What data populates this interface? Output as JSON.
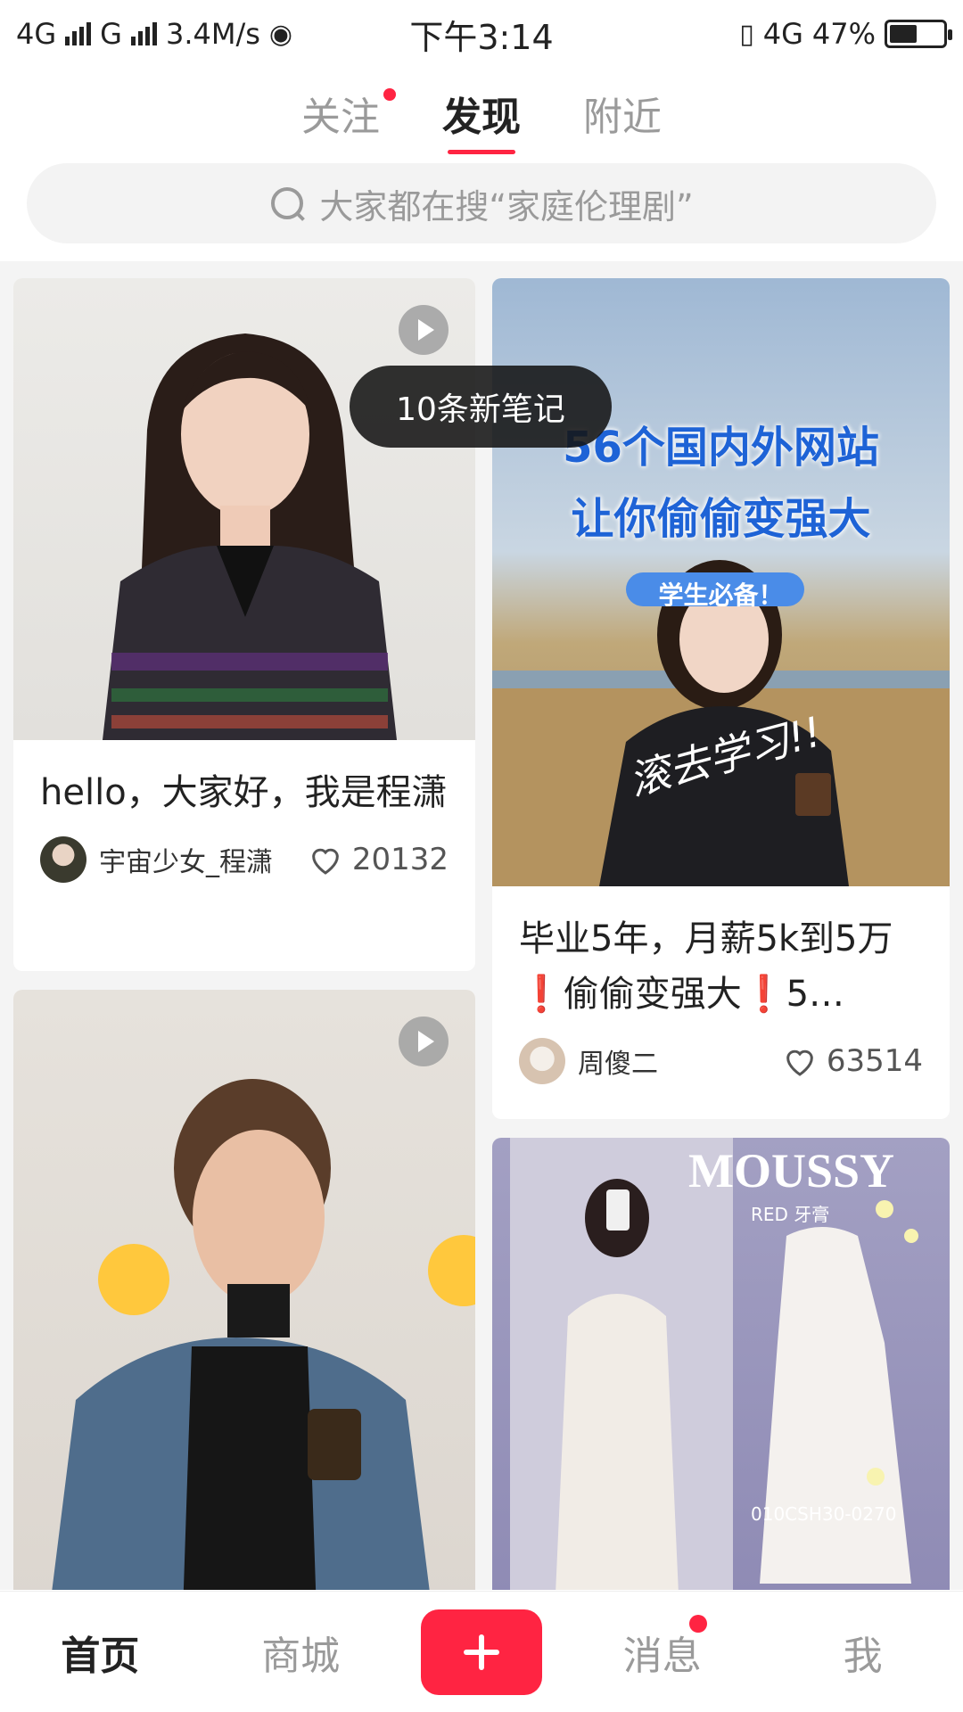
{
  "status_bar": {
    "network1": "4G",
    "network2": "G",
    "speed": "3.4M/s",
    "time": "下午3:14",
    "network3": "4G",
    "battery": "47%",
    "battery_level": 0.47
  },
  "top_tabs": [
    {
      "label": "关注",
      "has_dot": true
    },
    {
      "label": "发现",
      "active": true
    },
    {
      "label": "附近"
    }
  ],
  "search": {
    "placeholder": "大家都在搜“家庭伦理剧”"
  },
  "toast": "10条新笔记",
  "feed": {
    "card1": {
      "title": "hello，大家好，我是程潇",
      "author": "宇宙少女_程潇",
      "likes": "20132",
      "video": true
    },
    "card2": {
      "overlay_line1": "56个国内外网站",
      "overlay_line2": "让你偷偷变强大",
      "overlay_tag": "学生必备！",
      "overlay_script": "滚去学习!!",
      "title": "毕业5年，月薪5k到5万❗偷偷变强大❗5…",
      "author": "周傻二",
      "likes": "63514"
    },
    "card3": {
      "video": true
    },
    "card4": {
      "brand": "MOUSSY",
      "sub": "RED 牙膏",
      "code": "010CSH30-0270"
    }
  },
  "bottom_nav": [
    {
      "label": "首页",
      "active": true
    },
    {
      "label": "商城"
    },
    {
      "label": "plus"
    },
    {
      "label": "消息",
      "has_dot": true
    },
    {
      "label": "我"
    }
  ]
}
